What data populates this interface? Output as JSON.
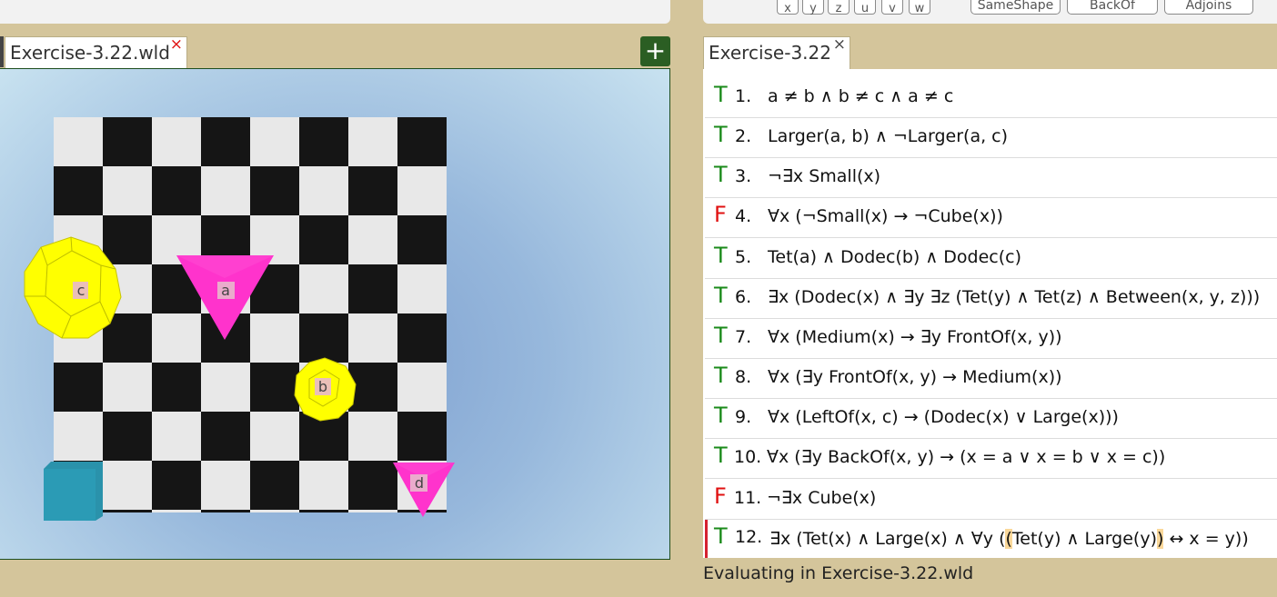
{
  "toolbar": {
    "variables": [
      "x",
      "y",
      "z",
      "u",
      "v",
      "w"
    ],
    "predicates": [
      "SameShape",
      "BackOf",
      "Adjoins"
    ]
  },
  "world_tab": {
    "label": "Exercise-3.22.wld",
    "close": "×"
  },
  "add_button": {
    "label": "+"
  },
  "sentences_tab": {
    "label": "Exercise-3.22",
    "close": "×"
  },
  "world": {
    "objects": [
      {
        "label": "c",
        "shape": "dodecahedron",
        "size": "large",
        "color": "#ffff00"
      },
      {
        "label": "a",
        "shape": "tetrahedron",
        "size": "large",
        "color": "#ff33cc"
      },
      {
        "label": "b",
        "shape": "dodecahedron",
        "size": "small",
        "color": "#ffff00"
      },
      {
        "label": "d",
        "shape": "tetrahedron",
        "size": "medium",
        "color": "#ff33cc"
      },
      {
        "label": "",
        "shape": "cube",
        "size": "medium",
        "color": "#2b9bb5"
      }
    ]
  },
  "sentences": [
    {
      "value": "T",
      "number": "1.",
      "formula": "a ≠ b ∧ b ≠ c ∧ a ≠ c"
    },
    {
      "value": "T",
      "number": "2.",
      "formula": "Larger(a, b) ∧ ¬Larger(a, c)"
    },
    {
      "value": "T",
      "number": "3.",
      "formula": "¬∃x Small(x)"
    },
    {
      "value": "F",
      "number": "4.",
      "formula": "∀x (¬Small(x) → ¬Cube(x))"
    },
    {
      "value": "T",
      "number": "5.",
      "formula": "Tet(a) ∧ Dodec(b) ∧ Dodec(c)"
    },
    {
      "value": "T",
      "number": "6.",
      "formula": "∃x (Dodec(x) ∧ ∃y ∃z (Tet(y) ∧ Tet(z) ∧ Between(x, y, z)))"
    },
    {
      "value": "T",
      "number": "7.",
      "formula": "∀x (Medium(x) → ∃y FrontOf(x, y))"
    },
    {
      "value": "T",
      "number": "8.",
      "formula": "∀x (∃y FrontOf(x, y) → Medium(x))"
    },
    {
      "value": "T",
      "number": "9.",
      "formula": "∀x (LeftOf(x, c) → (Dodec(x) ∨ Large(x)))"
    },
    {
      "value": "T",
      "number": "10.",
      "formula": "∀x (∃y BackOf(x, y) → (x = a ∨ x = b ∨ x = c))"
    },
    {
      "value": "F",
      "number": "11.",
      "formula": "¬∃x Cube(x)"
    },
    {
      "value": "T",
      "number": "12.",
      "formula_parts": [
        "∃x (Tet(x) ∧ Large(x) ∧ ∀y (",
        "(",
        "Tet(y) ∧ Large(y)",
        ")",
        " ↔ x = y))"
      ]
    }
  ],
  "status": "Evaluating in Exercise-3.22.wld",
  "colors": {
    "true": "#1a8a1a",
    "false": "#e01010",
    "background": "#d4c59b",
    "accent": "#2b5e23"
  }
}
